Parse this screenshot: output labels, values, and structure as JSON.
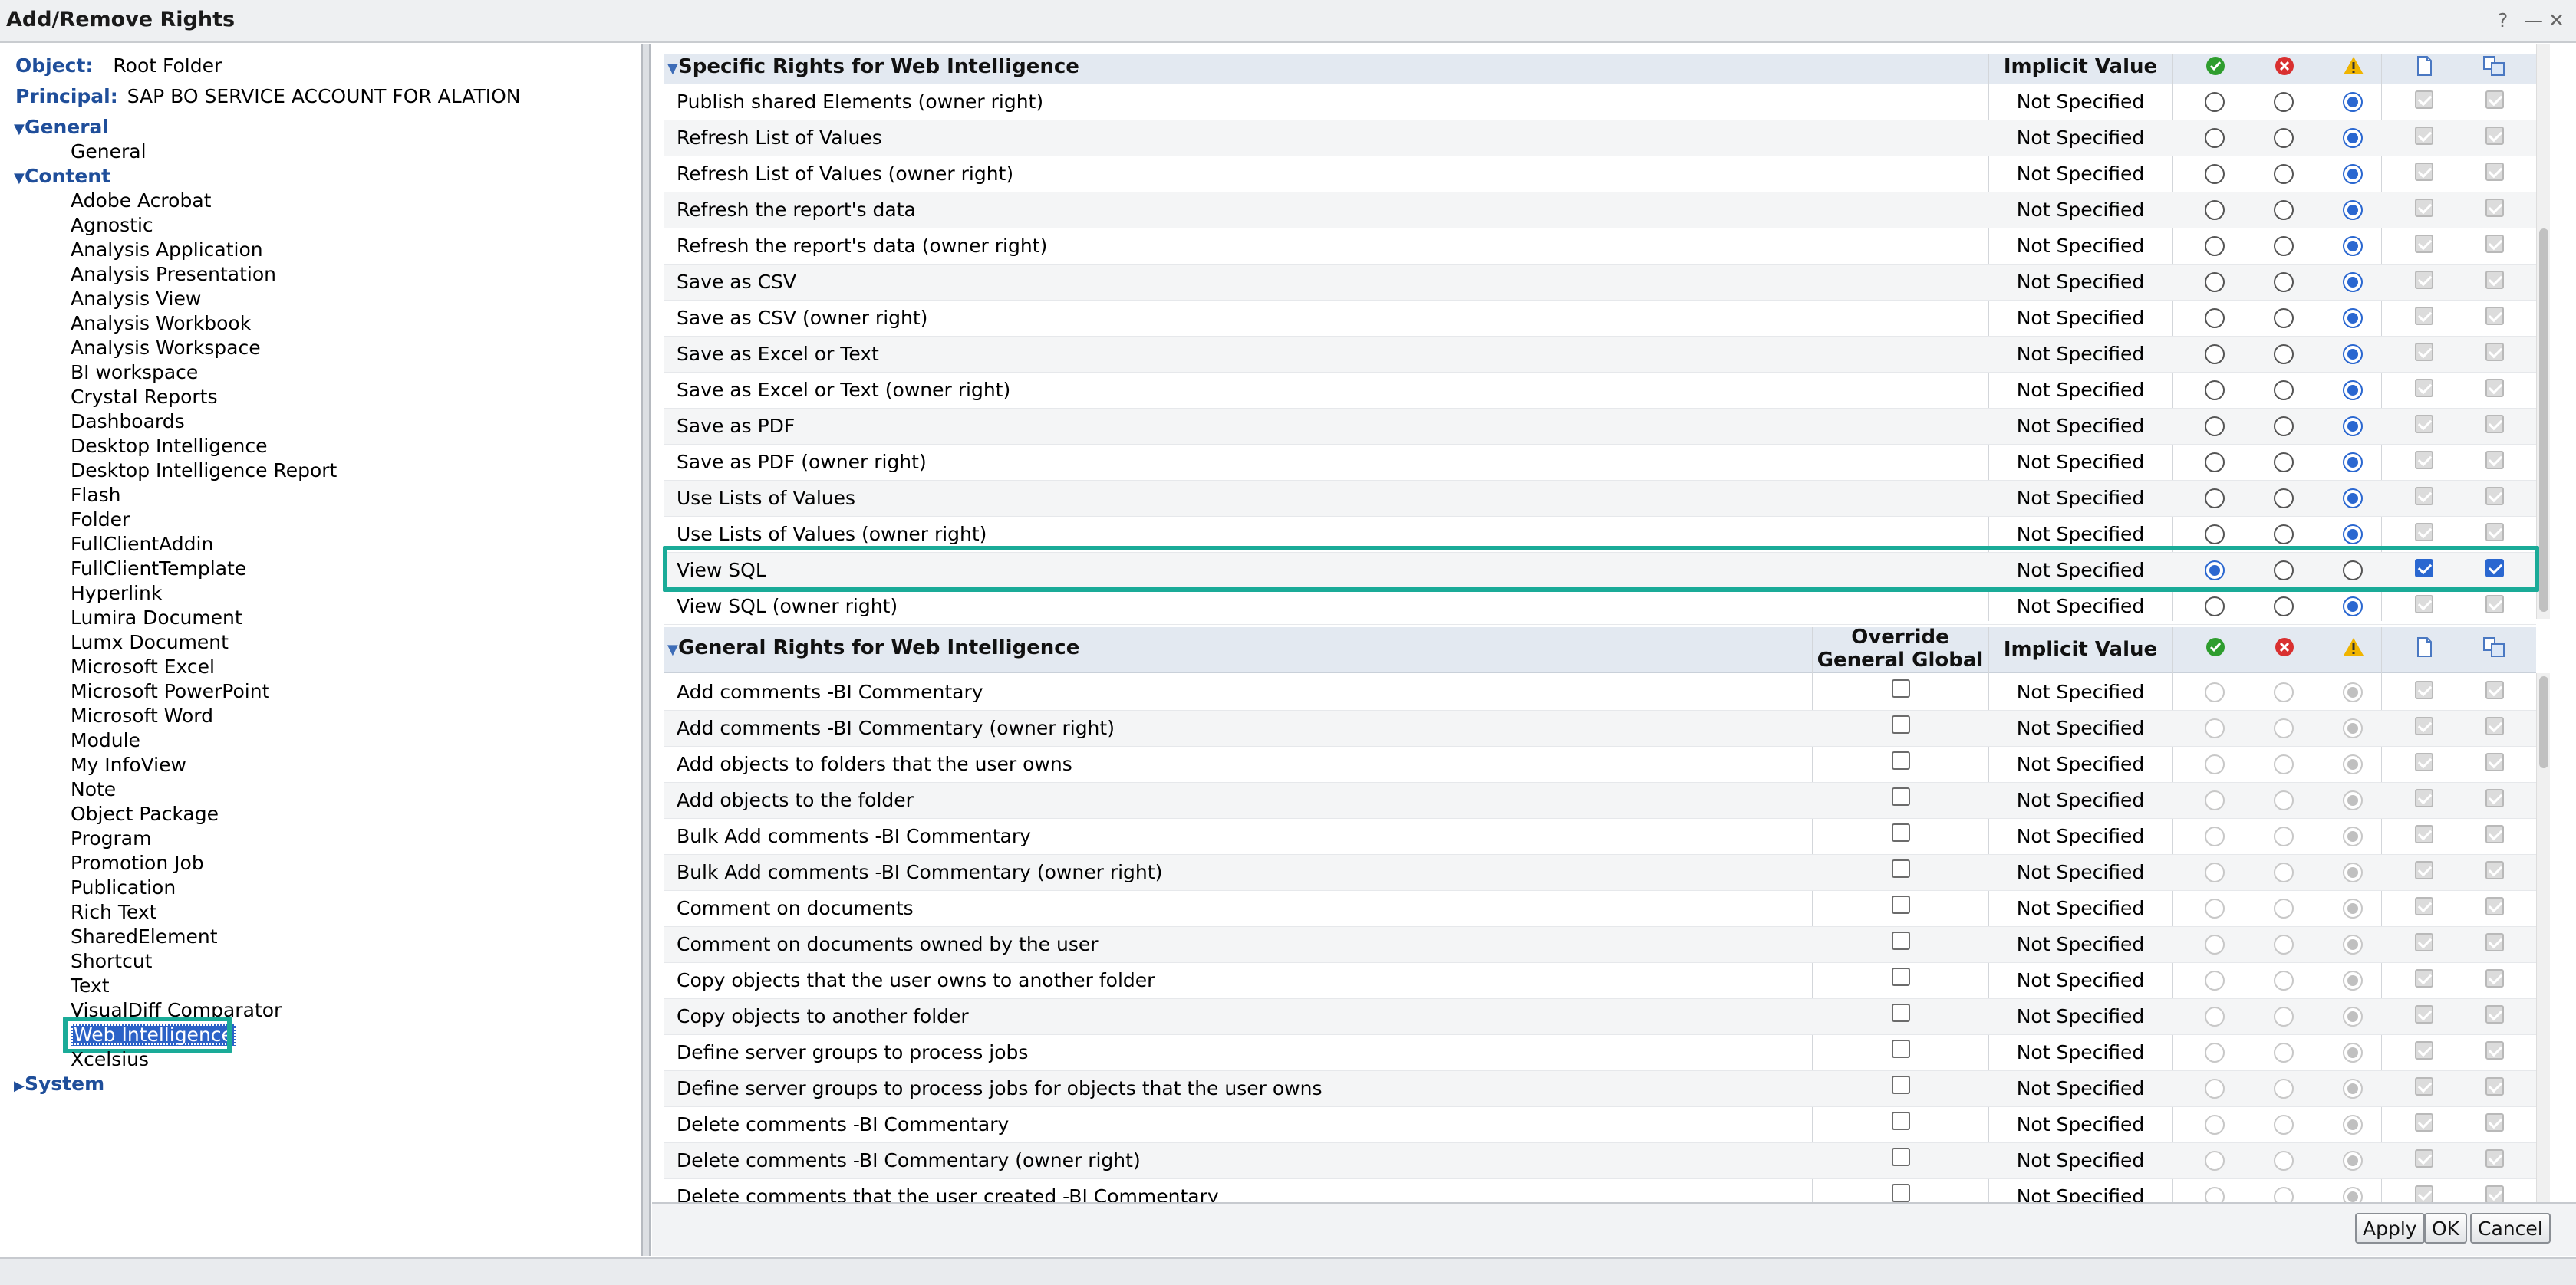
{
  "window": {
    "title": "Add/Remove Rights",
    "help": "?",
    "minimize": "—",
    "close": "✕"
  },
  "object": {
    "label": "Object:",
    "value": "Root Folder"
  },
  "principal": {
    "label": "Principal:",
    "value": "SAP BO SERVICE ACCOUNT FOR ALATION"
  },
  "tree": {
    "general": {
      "label": "General",
      "children": [
        "General"
      ]
    },
    "content": {
      "label": "Content",
      "children": [
        "Adobe Acrobat",
        "Agnostic",
        "Analysis Application",
        "Analysis Presentation",
        "Analysis View",
        "Analysis Workbook",
        "Analysis Workspace",
        "BI workspace",
        "Crystal Reports",
        "Dashboards",
        "Desktop Intelligence",
        "Desktop Intelligence Report",
        "Flash",
        "Folder",
        "FullClientAddin",
        "FullClientTemplate",
        "Hyperlink",
        "Lumira Document",
        "Lumx Document",
        "Microsoft Excel",
        "Microsoft PowerPoint",
        "Microsoft Word",
        "Module",
        "My InfoView",
        "Note",
        "Object Package",
        "Program",
        "Promotion Job",
        "Publication",
        "Rich Text",
        "SharedElement",
        "Shortcut",
        "Text",
        "VisualDiff Comparator",
        "Web Intelligence",
        "Xcelsius"
      ]
    },
    "system": {
      "label": "System"
    },
    "selected": "Web Intelligence"
  },
  "specific": {
    "title": "Specific Rights for Web Intelligence",
    "implicit_header": "Implicit Value",
    "rows": [
      {
        "name": "Publish shared Elements (owner right)",
        "implicit": "Not Specified",
        "grant": false,
        "deny": false,
        "nspec": true,
        "apply_obj": false,
        "apply_sub": false
      },
      {
        "name": "Refresh List of Values",
        "implicit": "Not Specified",
        "grant": false,
        "deny": false,
        "nspec": true
      },
      {
        "name": "Refresh List of Values (owner right)",
        "implicit": "Not Specified",
        "grant": false,
        "deny": false,
        "nspec": true
      },
      {
        "name": "Refresh the report's data",
        "implicit": "Not Specified",
        "grant": false,
        "deny": false,
        "nspec": true
      },
      {
        "name": "Refresh the report's data (owner right)",
        "implicit": "Not Specified",
        "grant": false,
        "deny": false,
        "nspec": true
      },
      {
        "name": "Save as CSV",
        "implicit": "Not Specified",
        "grant": false,
        "deny": false,
        "nspec": true
      },
      {
        "name": "Save as CSV (owner right)",
        "implicit": "Not Specified",
        "grant": false,
        "deny": false,
        "nspec": true
      },
      {
        "name": "Save as Excel or Text",
        "implicit": "Not Specified",
        "grant": false,
        "deny": false,
        "nspec": true
      },
      {
        "name": "Save as Excel or Text (owner right)",
        "implicit": "Not Specified",
        "grant": false,
        "deny": false,
        "nspec": true
      },
      {
        "name": "Save as PDF",
        "implicit": "Not Specified",
        "grant": false,
        "deny": false,
        "nspec": true
      },
      {
        "name": "Save as PDF (owner right)",
        "implicit": "Not Specified",
        "grant": false,
        "deny": false,
        "nspec": true
      },
      {
        "name": "Use Lists of Values",
        "implicit": "Not Specified",
        "grant": false,
        "deny": false,
        "nspec": true
      },
      {
        "name": "Use Lists of Values (owner right)",
        "implicit": "Not Specified",
        "grant": false,
        "deny": false,
        "nspec": true
      },
      {
        "name": "View SQL",
        "implicit": "Not Specified",
        "grant": true,
        "deny": false,
        "nspec": false,
        "highlight": true
      },
      {
        "name": "View SQL (owner right)",
        "implicit": "Not Specified",
        "grant": false,
        "deny": false,
        "nspec": true
      }
    ]
  },
  "general": {
    "title": "General Rights for Web Intelligence",
    "override_header": "Override General Global",
    "implicit_header": "Implicit Value",
    "rows": [
      {
        "name": "Add comments -BI Commentary",
        "implicit": "Not Specified"
      },
      {
        "name": "Add comments -BI Commentary (owner right)",
        "implicit": "Not Specified"
      },
      {
        "name": "Add objects to folders that the user owns",
        "implicit": "Not Specified"
      },
      {
        "name": "Add objects to the folder",
        "implicit": "Not Specified"
      },
      {
        "name": "Bulk Add comments -BI Commentary",
        "implicit": "Not Specified"
      },
      {
        "name": "Bulk Add comments -BI Commentary (owner right)",
        "implicit": "Not Specified"
      },
      {
        "name": "Comment on documents",
        "implicit": "Not Specified"
      },
      {
        "name": "Comment on documents owned by the user",
        "implicit": "Not Specified"
      },
      {
        "name": "Copy objects that the user owns to another folder",
        "implicit": "Not Specified"
      },
      {
        "name": "Copy objects to another folder",
        "implicit": "Not Specified"
      },
      {
        "name": "Define server groups to process jobs",
        "implicit": "Not Specified"
      },
      {
        "name": "Define server groups to process jobs for objects that the user owns",
        "implicit": "Not Specified"
      },
      {
        "name": "Delete comments -BI Commentary",
        "implicit": "Not Specified"
      },
      {
        "name": "Delete comments -BI Commentary (owner right)",
        "implicit": "Not Specified"
      },
      {
        "name": "Delete comments that the user created -BI Commentary",
        "implicit": "Not Specified"
      }
    ]
  },
  "buttons": {
    "apply": "Apply",
    "ok": "OK",
    "cancel": "Cancel"
  },
  "colors": {
    "highlight": "#1aab98",
    "accent": "#2a67d0",
    "grant": "#2e9d2e",
    "deny": "#d93030",
    "warn": "#f0b400"
  }
}
